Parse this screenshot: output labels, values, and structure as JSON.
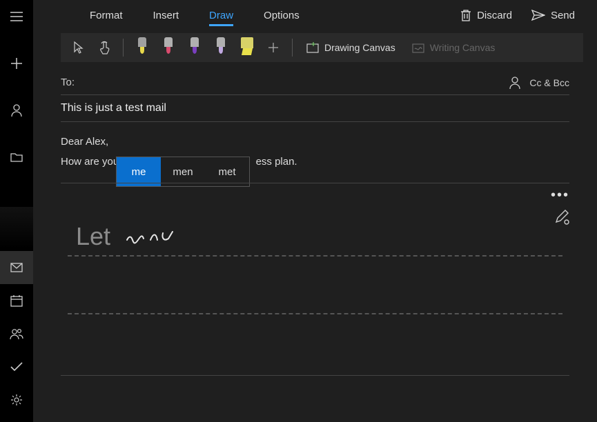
{
  "sidebar": {
    "top": [
      {
        "name": "menu-icon"
      },
      {
        "name": "add-icon"
      },
      {
        "name": "person-icon"
      },
      {
        "name": "folder-icon"
      }
    ],
    "bottom": [
      {
        "name": "mail-icon",
        "active": true
      },
      {
        "name": "calendar-icon"
      },
      {
        "name": "people-icon"
      },
      {
        "name": "todo-icon"
      },
      {
        "name": "settings-icon"
      }
    ]
  },
  "tabs": {
    "items": [
      "Format",
      "Insert",
      "Draw",
      "Options"
    ],
    "active_index": 2
  },
  "header_actions": {
    "discard": "Discard",
    "send": "Send"
  },
  "toolbar": {
    "pens": [
      {
        "body": "#a0a0a0",
        "tip": "#e8d94b",
        "type": "marker"
      },
      {
        "body": "#b0b0b0",
        "tip": "#d94b6e",
        "type": "pen"
      },
      {
        "body": "#b0b0b0",
        "tip": "#7a3fbf",
        "type": "pen"
      },
      {
        "body": "#b0b0b0",
        "tip": "#bfa8e0",
        "type": "pen"
      },
      {
        "body": "#d8d268",
        "tip": "#e8e04b",
        "type": "highlighter"
      }
    ],
    "drawing_canvas": "Drawing Canvas",
    "writing_canvas": "Writing Canvas"
  },
  "compose": {
    "to_label": "To:",
    "ccbcc": "Cc & Bcc",
    "subject": "This is just a test mail",
    "body_line1": "Dear Alex,",
    "body_line2": "How are you",
    "body_line2_tail": "ess plan."
  },
  "suggestions": [
    "me",
    "men",
    "met"
  ],
  "suggestion_selected": 0,
  "handwriting": {
    "recognized": "Let"
  }
}
